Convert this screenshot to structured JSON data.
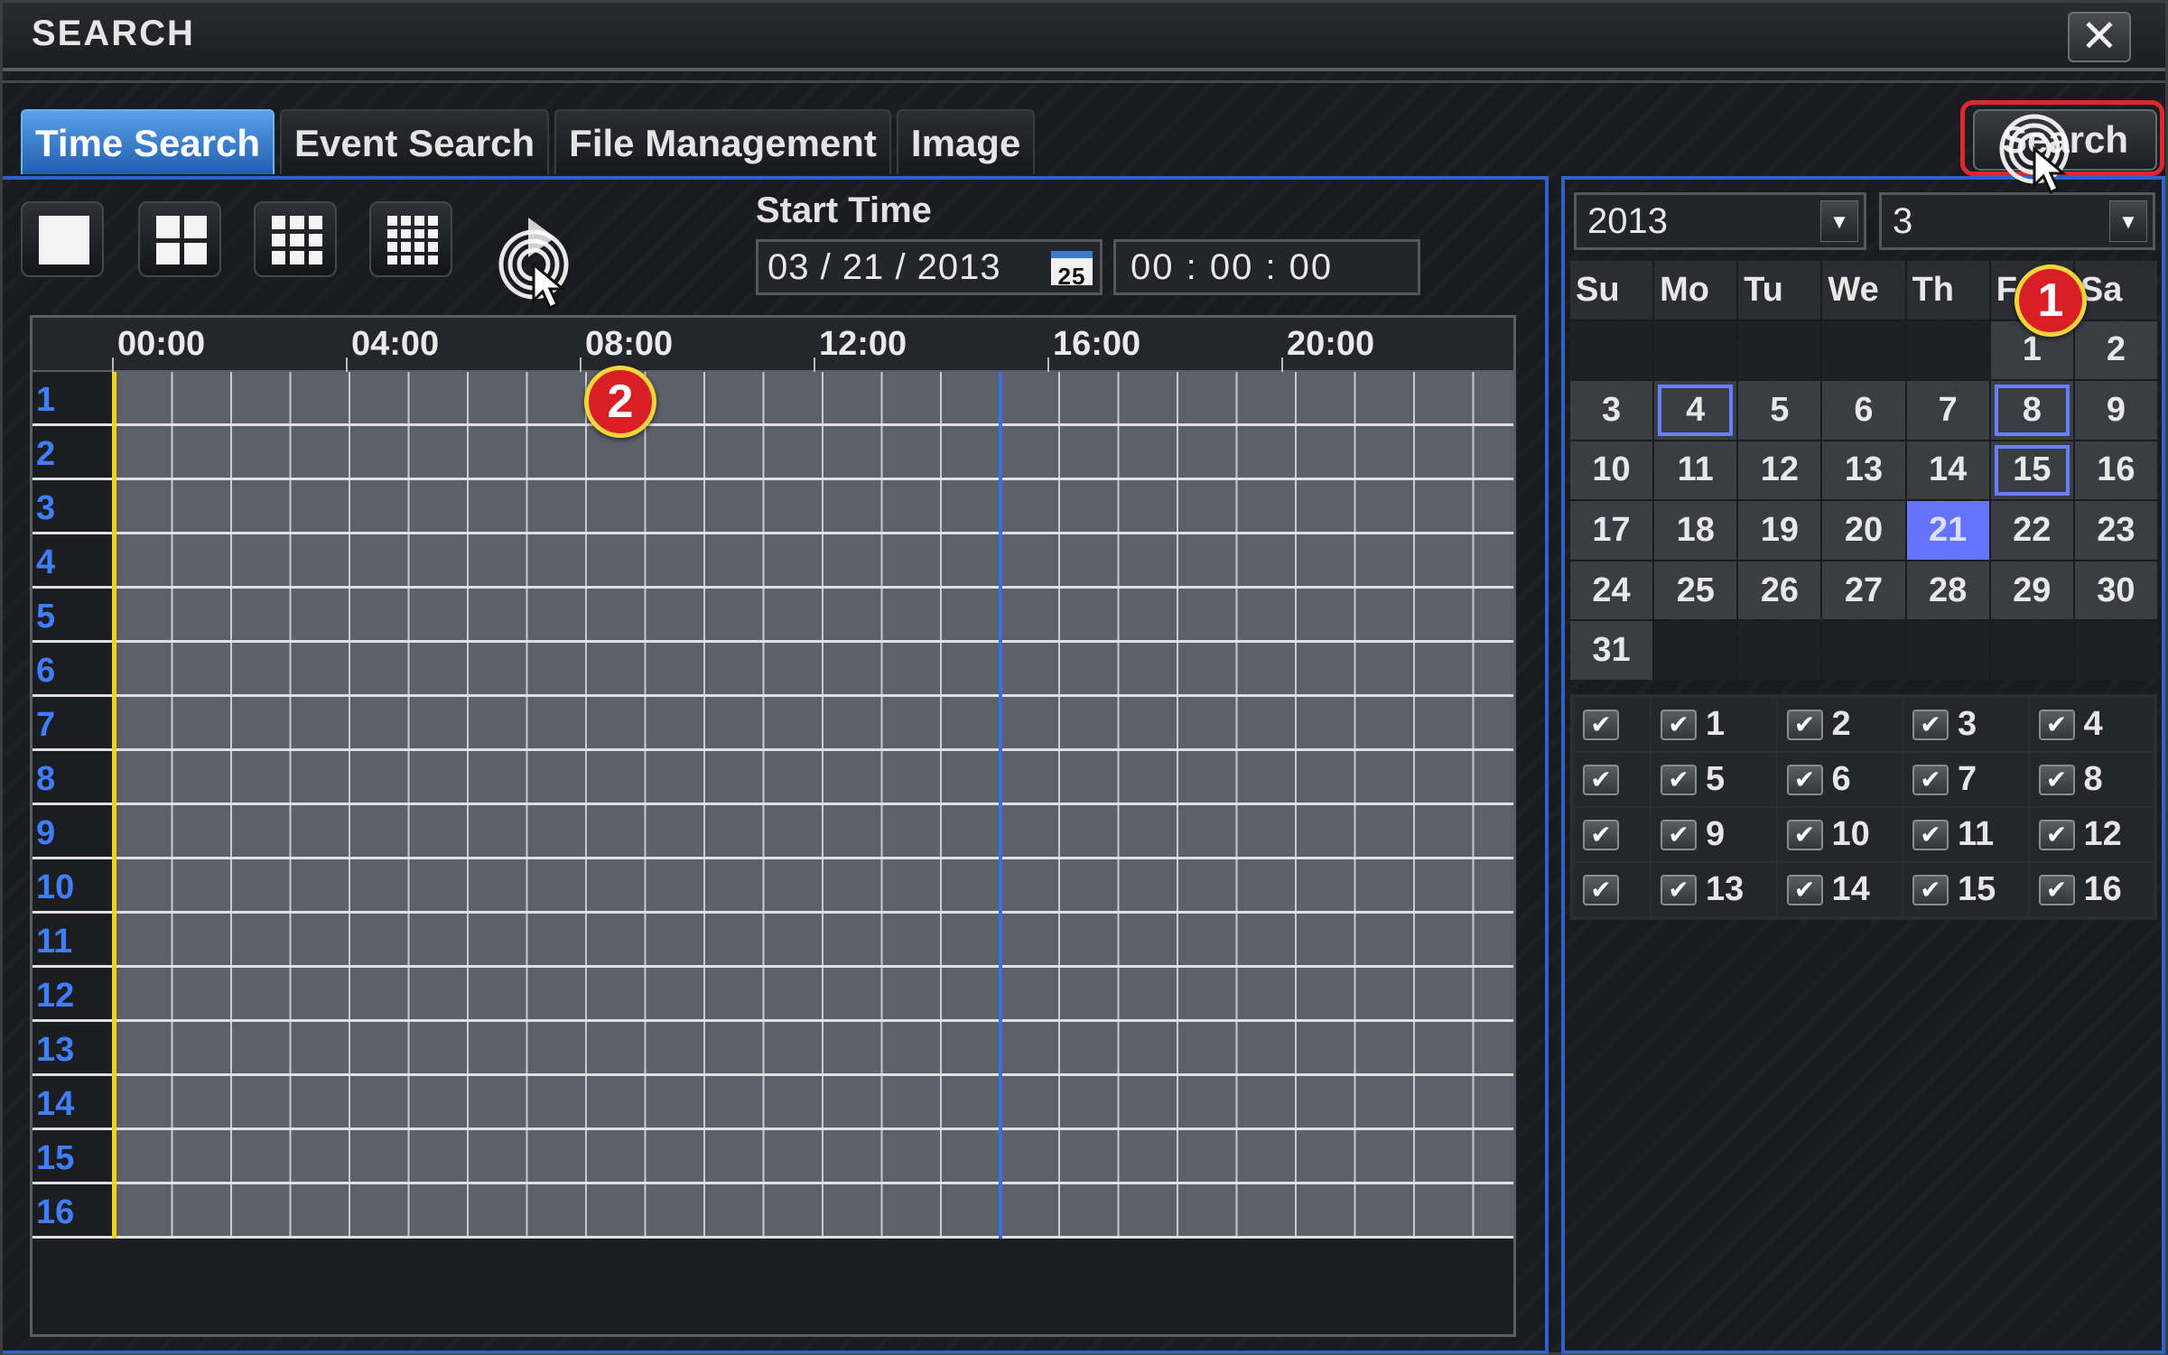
{
  "window": {
    "title": "SEARCH",
    "close_label": "✕"
  },
  "tabs": [
    "Time Search",
    "Event Search",
    "File Management",
    "Image"
  ],
  "active_tab": "Time Search",
  "search_button": "Search",
  "start_time": {
    "label": "Start Time",
    "date": "03 / 21 / 2013",
    "calendar_icon_text": "25",
    "time": "00 : 00 : 00"
  },
  "timeline": {
    "hours": [
      "00:00",
      "04:00",
      "08:00",
      "12:00",
      "16:00",
      "20:00"
    ],
    "channels": [
      "1",
      "2",
      "3",
      "4",
      "5",
      "6",
      "7",
      "8",
      "9",
      "10",
      "11",
      "12",
      "13",
      "14",
      "15",
      "16"
    ]
  },
  "year_select": "2013",
  "month_select": "3",
  "calendar": {
    "weekdays": [
      "Su",
      "Mo",
      "Tu",
      "We",
      "Th",
      "Fr",
      "Sa"
    ],
    "days": [
      "",
      "",
      "",
      "",
      "",
      "1",
      "2",
      "3",
      "4",
      "5",
      "6",
      "7",
      "8",
      "9",
      "10",
      "11",
      "12",
      "13",
      "14",
      "15",
      "16",
      "17",
      "18",
      "19",
      "20",
      "21",
      "22",
      "23",
      "24",
      "25",
      "26",
      "27",
      "28",
      "29",
      "30",
      "31",
      "",
      "",
      "",
      "",
      "",
      ""
    ],
    "recorded_days": [
      "4",
      "8",
      "15"
    ],
    "selected_day": "21"
  },
  "channel_checks": [
    [
      "",
      "1",
      "2",
      "3",
      "4"
    ],
    [
      "",
      "5",
      "6",
      "7",
      "8"
    ],
    [
      "",
      "9",
      "10",
      "11",
      "12"
    ],
    [
      "",
      "13",
      "14",
      "15",
      "16"
    ]
  ],
  "annotations": {
    "badge1": "1",
    "badge2": "2"
  },
  "colors": {
    "accent_blue": "#2e62c8",
    "highlight_red": "#e0262f",
    "selected_day": "#6673ff",
    "timeline_marker": "#f2d21a"
  }
}
